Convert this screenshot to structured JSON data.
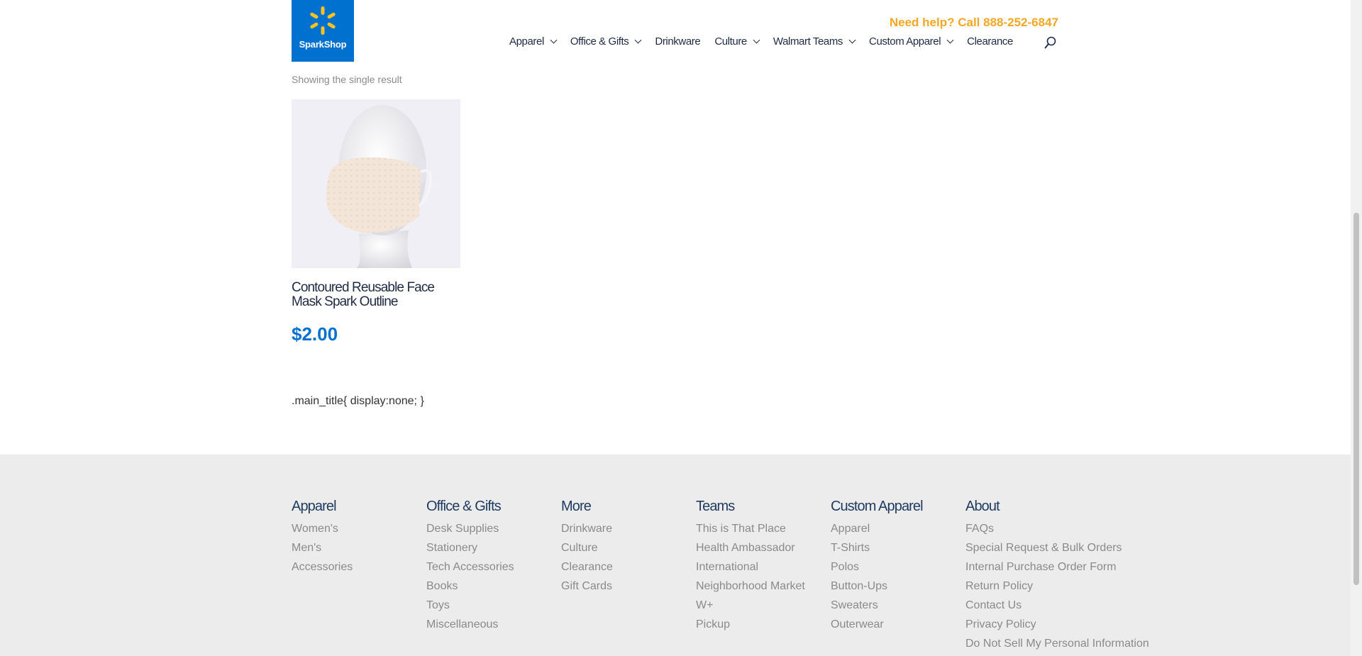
{
  "header": {
    "logo_text": "SparkShop",
    "help_text": "Need help? Call 888-252-6847",
    "nav": [
      {
        "label": "Apparel",
        "has_dropdown": true
      },
      {
        "label": "Office & Gifts",
        "has_dropdown": true
      },
      {
        "label": "Drinkware",
        "has_dropdown": false
      },
      {
        "label": "Culture",
        "has_dropdown": true
      },
      {
        "label": "Walmart Teams",
        "has_dropdown": true
      },
      {
        "label": "Custom Apparel",
        "has_dropdown": true
      },
      {
        "label": "Clearance",
        "has_dropdown": false
      }
    ],
    "search_icon": "search-icon"
  },
  "main": {
    "result_count": "Showing the single result",
    "product": {
      "title": "Contoured Reusable Face Mask Spark Outline",
      "price": "$2.00"
    },
    "css_text": ".main_title{ display:none; }"
  },
  "footer": {
    "columns": [
      {
        "heading": "Apparel",
        "links": [
          "Women's",
          "Men's",
          "Accessories"
        ]
      },
      {
        "heading": "Office & Gifts",
        "links": [
          "Desk Supplies",
          "Stationery",
          "Tech Accessories",
          "Books",
          "Toys",
          "Miscellaneous"
        ]
      },
      {
        "heading": "More",
        "links": [
          "Drinkware",
          "Culture",
          "Clearance",
          "Gift Cards"
        ]
      },
      {
        "heading": "Teams",
        "links": [
          "This is That Place",
          "Health Ambassador",
          "International",
          "Neighborhood Market",
          "W+",
          "Pickup"
        ]
      },
      {
        "heading": "Custom Apparel",
        "links": [
          "Apparel",
          "T-Shirts",
          "Polos",
          "Button-Ups",
          "Sweaters",
          "Outerwear"
        ]
      },
      {
        "heading": "About",
        "links": [
          "FAQs",
          "Special Request & Bulk Orders",
          "Internal Purchase Order Form",
          "Return Policy",
          "Contact Us",
          "Privacy Policy",
          "Do Not Sell My Personal Information"
        ]
      }
    ]
  },
  "colors": {
    "brand_blue": "#0071ce",
    "help_orange": "#f5a623",
    "footer_bg": "#ececec"
  }
}
